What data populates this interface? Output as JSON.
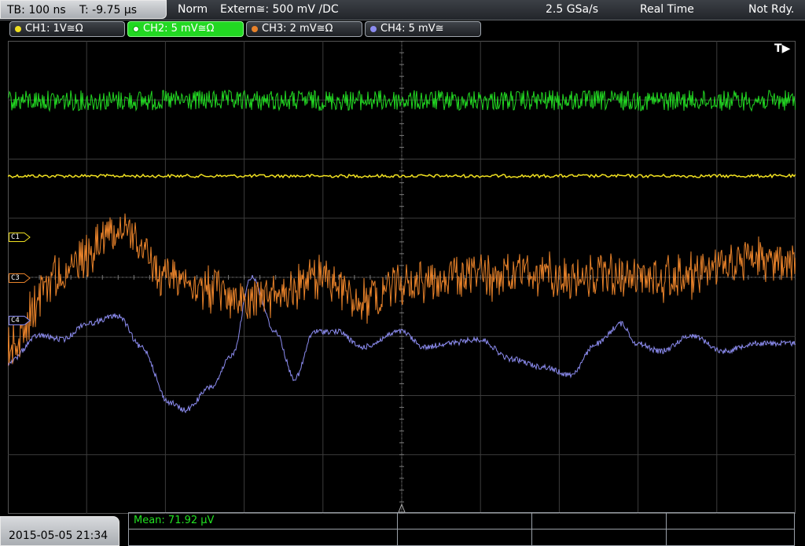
{
  "top_bar": {
    "timebase": "TB: 100 ns",
    "trigger_time": "T: -9.75 µs",
    "acq_mode": "Norm",
    "trigger_source": "Extern≅: 500 mV ∕DC",
    "sample_rate": "2.5 GSa/s",
    "realtime": "Real Time",
    "status": "Not Rdy."
  },
  "channels": [
    {
      "label": "CH1: 1V≅Ω",
      "color": "#f0e020",
      "active": false
    },
    {
      "label": "CH2: 5 mV≅Ω",
      "color": "#22d822",
      "active": true
    },
    {
      "label": "CH3: 2 mV≅Ω",
      "color": "#e8822a",
      "active": false
    },
    {
      "label": "CH4: 5 mV≅",
      "color": "#8c8cf0",
      "active": false
    }
  ],
  "markers": {
    "c1": "C1",
    "c3": "C3",
    "c4": "C4",
    "trigger": "T"
  },
  "colors": {
    "ch1": "#f0e020",
    "ch2": "#22d822",
    "ch3": "#e8822a",
    "ch4": "#8c8cf0",
    "grid": "#3c3c3c"
  },
  "bottom": {
    "datetime": "2015-05-05 21:34",
    "measurement": "Mean: 71.92 µV"
  }
}
